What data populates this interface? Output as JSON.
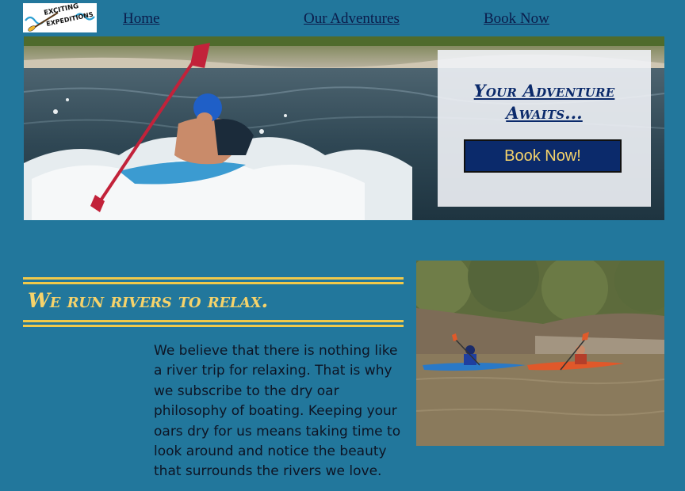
{
  "logo": {
    "line1": "EXCITING",
    "line2": "EXPEDITIONS",
    "icon": "paddle-wave-logo-icon"
  },
  "nav": {
    "home": "Home",
    "adventures": "Our Adventures",
    "book": "Book Now"
  },
  "hero": {
    "image": "kayaker-whitewater-image",
    "title_line1": "Your Adventure",
    "title_line2": "Awaits...",
    "button": "Book Now!"
  },
  "section": {
    "heading": "We run rivers to relax.",
    "body": "We believe that there is nothing like a river trip for relaxing. That is why we subscribe to the dry oar philosophy of boating. Keeping your oars dry for us means taking time to look around and notice the beauty that surrounds the rivers we love.",
    "image": "two-kayakers-calm-river-image"
  },
  "colors": {
    "background": "#22779c",
    "accent_gold": "#f5d36b",
    "navy": "#0b2a6b"
  }
}
